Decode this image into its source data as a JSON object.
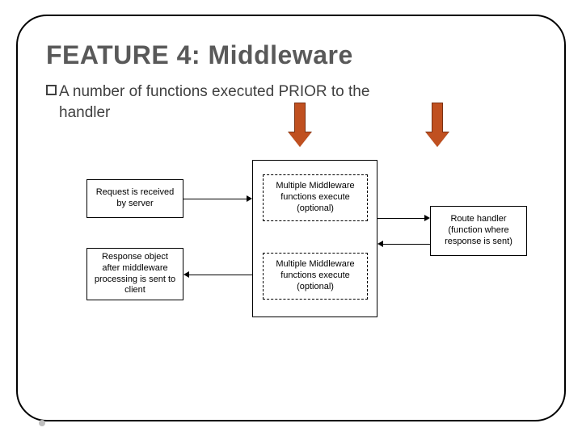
{
  "title": "FEATURE 4: Middleware",
  "bullet": {
    "line1": "A number of functions executed PRIOR to the",
    "line2": "handler"
  },
  "boxes": {
    "request": "Request is received by server",
    "response": "Response object after middleware processing is sent to client",
    "mw_top": "Multiple Middleware functions execute (optional)",
    "mw_bottom": "Multiple Middleware functions execute (optional)",
    "handler": "Route handler (function where response is sent)"
  }
}
